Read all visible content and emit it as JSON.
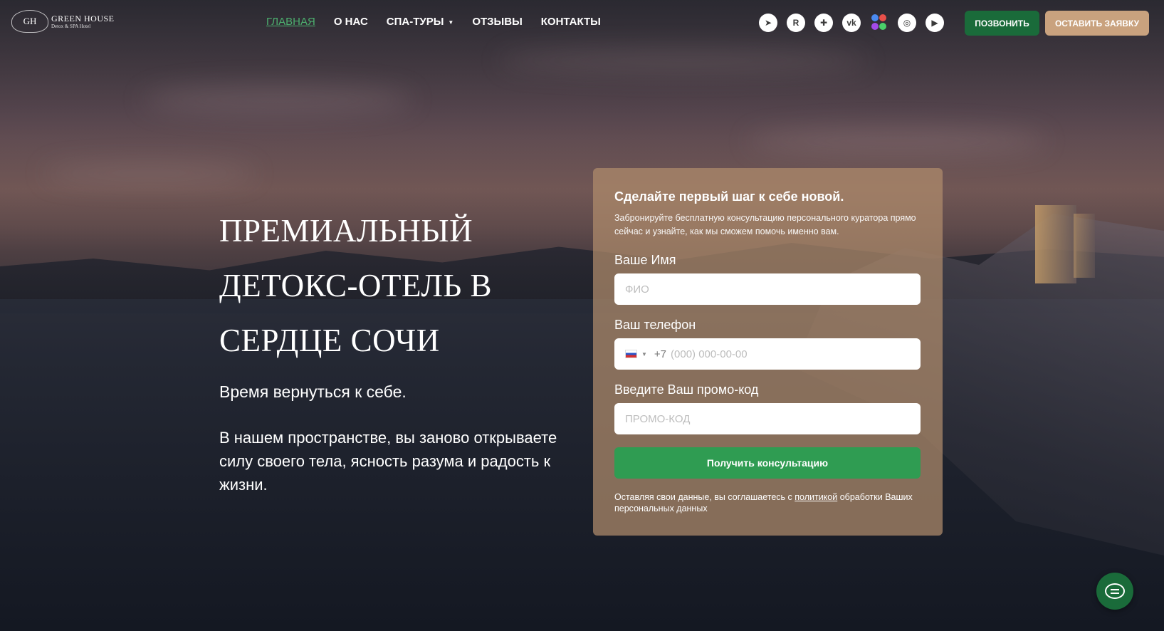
{
  "brand": {
    "logo_monogram": "GH",
    "name": "GREEN HOUSE",
    "subtitle": "Detox & SPA Hotel"
  },
  "nav": {
    "items": [
      {
        "label": "ГЛАВНАЯ",
        "active": true
      },
      {
        "label": "О НАС"
      },
      {
        "label": "СПА-ТУРЫ",
        "dropdown": true
      },
      {
        "label": "ОТЗЫВЫ"
      },
      {
        "label": "КОНТАКТЫ"
      }
    ]
  },
  "socials": {
    "telegram_glyph": "➤",
    "rutube_glyph": "R",
    "plus_glyph": "✚",
    "vk_glyph": "vk",
    "instagram_glyph": "◎",
    "youtube_glyph": "▶"
  },
  "header_buttons": {
    "call": "ПОЗВОНИТЬ",
    "request": "ОСТАВИТЬ ЗАЯВКУ"
  },
  "hero": {
    "title_line1": "ПРЕМИАЛЬНЫЙ",
    "title_line2": "ДЕТОКС-ОТЕЛЬ В",
    "title_line3": "СЕРДЦЕ СОЧИ",
    "tagline": "Время вернуться к себе.",
    "description": "В нашем пространстве, вы заново открываете силу своего тела, ясность разума и радость к жизни."
  },
  "form": {
    "title": "Сделайте первый шаг к себе новой.",
    "subtitle": "Забронируйте бесплатную консультацию персонального куратора прямо сейчас и узнайте, как мы сможем помочь именно вам.",
    "name_label": "Ваше Имя",
    "name_placeholder": "ФИО",
    "phone_label": "Ваш телефон",
    "phone_prefix": "+7",
    "phone_placeholder": "(000) 000-00-00",
    "promo_label": "Введите Ваш промо-код",
    "promo_placeholder": "ПРОМО-КОД",
    "submit": "Получить консультацию",
    "consent_before": "Оставляя свои данные, вы соглашаетесь с ",
    "consent_link": "политикой",
    "consent_after": " обработки Ваших персональных данных"
  },
  "colors": {
    "accent_green": "#1a6b3a",
    "submit_green": "#2f9c52",
    "request_tan": "#c9a27e",
    "active_nav": "#4caf6e"
  }
}
